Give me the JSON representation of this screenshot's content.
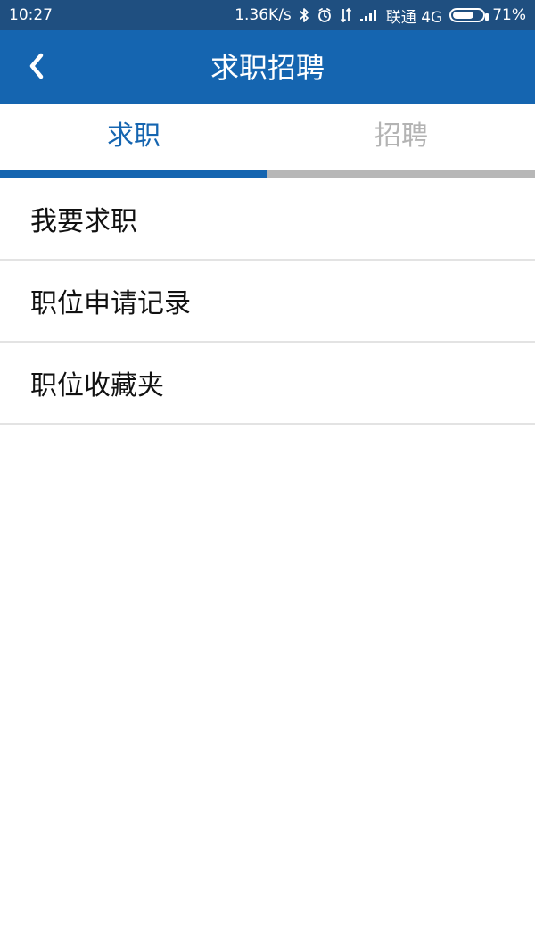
{
  "status_bar": {
    "time": "10:27",
    "network_speed": "1.36K/s",
    "carrier": "联通 4G",
    "battery_percent": "71%",
    "battery_level": 0.71,
    "icons": [
      "bluetooth-icon",
      "alarm-icon",
      "data-arrows-icon",
      "signal-icon",
      "battery-icon"
    ]
  },
  "appbar": {
    "title": "求职招聘",
    "back_icon": "chevron-left-icon"
  },
  "tabs": [
    {
      "label": "求职",
      "active": true
    },
    {
      "label": "招聘",
      "active": false
    }
  ],
  "list": {
    "items": [
      {
        "label": "我要求职"
      },
      {
        "label": "职位申请记录"
      },
      {
        "label": "职位收藏夹"
      }
    ]
  },
  "colors": {
    "status_bar_bg": "#1f4f80",
    "primary": "#1565b0",
    "tab_inactive_text": "#b3b3b3",
    "tab_inactive_bar": "#b7b7b7",
    "divider": "#e3e3e3"
  }
}
